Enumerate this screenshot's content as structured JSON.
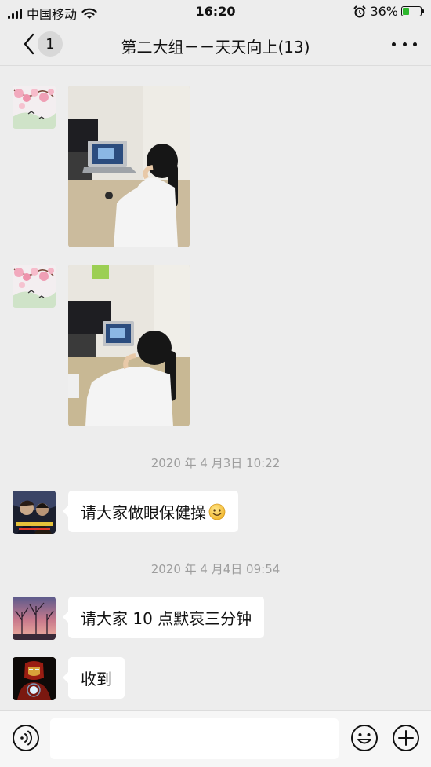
{
  "status_bar": {
    "carrier": "中国移动",
    "time": "16:20",
    "battery": "36%",
    "battery_level": 0.36
  },
  "nav": {
    "back_count": "1",
    "title": "第二大组－－天天向上(13)"
  },
  "messages": [
    {
      "type": "image",
      "avatar": "peach-blossom-avatar",
      "content": "photo-girl-at-laptop-1"
    },
    {
      "type": "image",
      "avatar": "peach-blossom-avatar",
      "content": "photo-girl-at-laptop-2"
    },
    {
      "type": "timestamp",
      "text": "2020 年 4 月3日 10:22"
    },
    {
      "type": "text",
      "avatar": "movie-poster-avatar",
      "text": "请大家做眼保健操",
      "emoji": "smiley-emoji"
    },
    {
      "type": "timestamp",
      "text": "2020 年 4 月4日 09:54"
    },
    {
      "type": "text",
      "avatar": "sunset-trees-avatar",
      "text": "请大家 10 点默哀三分钟"
    },
    {
      "type": "text",
      "avatar": "iron-man-avatar",
      "text": "收到"
    }
  ],
  "input_bar": {
    "voice_icon": "voice-icon",
    "emoji_icon": "emoji-icon",
    "plus_icon": "plus-icon",
    "value": ""
  },
  "colors": {
    "background": "#ededed",
    "bubble": "#ffffff",
    "timestamp": "#9d9d9d",
    "battery_charge": "#2eb82e"
  }
}
